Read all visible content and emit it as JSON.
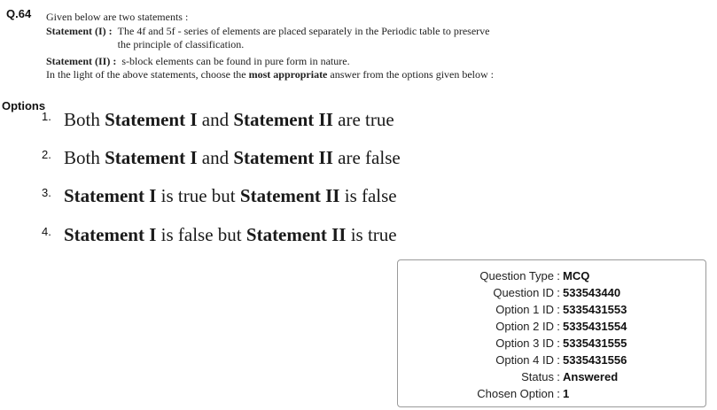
{
  "question": {
    "number": "Q.64",
    "intro": "Given below are two statements :",
    "statement1_label": "Statement (I) :",
    "statement1_text": "The 4f and 5f - series of elements are placed separately in the Periodic table to preserve the principle of classification.",
    "statement2_label": "Statement (II) :",
    "statement2_text": "s-block elements can be found in pure form in nature.",
    "instruction_pre": "In the light of the above statements, choose the ",
    "instruction_bold": "most appropriate",
    "instruction_post": " answer from the options given below :"
  },
  "options_label": "Options",
  "options": [
    {
      "num": "1.",
      "parts": [
        "Both ",
        "Statement I",
        " and ",
        "Statement II",
        " are true"
      ]
    },
    {
      "num": "2.",
      "parts": [
        "Both ",
        "Statement I",
        " and ",
        "Statement II",
        " are false"
      ]
    },
    {
      "num": "3.",
      "parts": [
        "",
        "Statement I",
        " is true but ",
        "Statement II",
        " is false"
      ]
    },
    {
      "num": "4.",
      "parts": [
        "",
        "Statement I",
        " is false but ",
        "Statement II",
        " is true"
      ]
    }
  ],
  "info": {
    "question_type_label": "Question Type",
    "question_type": "MCQ",
    "question_id_label": "Question ID",
    "question_id": "533543440",
    "option1_id_label": "Option 1 ID",
    "option1_id": "5335431553",
    "option2_id_label": "Option 2 ID",
    "option2_id": "5335431554",
    "option3_id_label": "Option 3 ID",
    "option3_id": "5335431555",
    "option4_id_label": "Option 4 ID",
    "option4_id": "5335431556",
    "status_label": "Status",
    "status": "Answered",
    "chosen_option_label": "Chosen Option",
    "chosen_option": "1",
    "separator": ":"
  }
}
